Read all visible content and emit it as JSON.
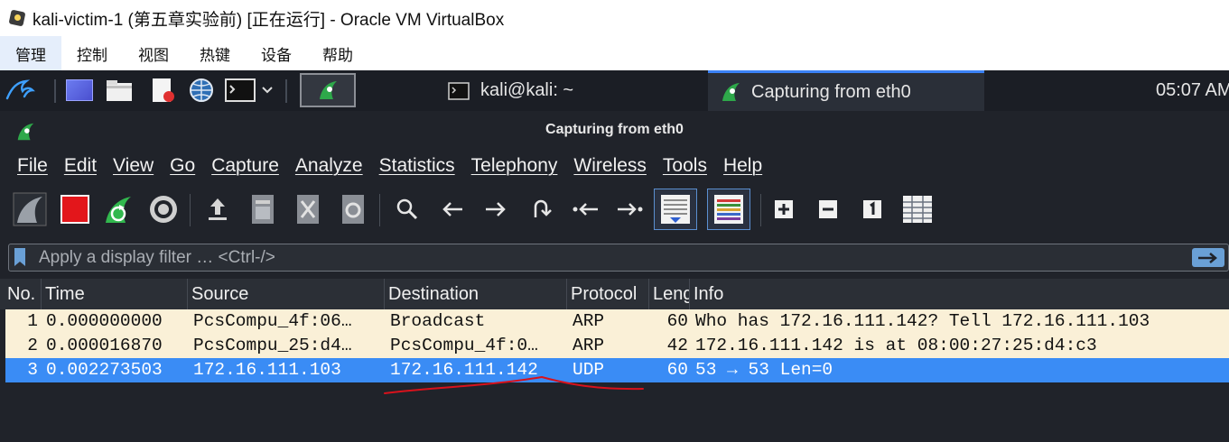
{
  "host_window": {
    "title": "kali-victim-1 (第五章实验前) [正在运行] - Oracle VM VirtualBox",
    "menu": [
      "管理",
      "控制",
      "视图",
      "热键",
      "设备",
      "帮助"
    ]
  },
  "kali_panel": {
    "tasks": [
      {
        "label": "kali@kali: ~",
        "icon": "terminal-icon"
      },
      {
        "label": "Capturing from eth0",
        "icon": "wireshark-fin-icon"
      }
    ],
    "clock": "05:07 AM"
  },
  "wireshark": {
    "title": "Capturing from eth0",
    "menu": [
      "File",
      "Edit",
      "View",
      "Go",
      "Capture",
      "Analyze",
      "Statistics",
      "Telephony",
      "Wireless",
      "Tools",
      "Help"
    ],
    "toolbar_icons": [
      "start-capture-icon",
      "stop-capture-icon",
      "restart-capture-icon",
      "capture-options-icon",
      "open-file-icon",
      "save-file-icon",
      "close-file-icon",
      "reload-file-icon",
      "find-packet-icon",
      "go-back-icon",
      "go-forward-icon",
      "go-to-packet-icon",
      "first-packet-icon",
      "last-packet-icon",
      "autoscroll-icon",
      "colorize-icon",
      "zoom-in-icon",
      "zoom-out-icon",
      "normal-size-icon",
      "resize-columns-icon"
    ],
    "filter": {
      "placeholder": "Apply a display filter … <Ctrl-/>",
      "value": ""
    },
    "columns": [
      "No.",
      "Time",
      "Source",
      "Destination",
      "Protocol",
      "Length",
      "Info"
    ],
    "packets": [
      {
        "no": "1",
        "time": "0.000000000",
        "source": "PcsCompu_4f:06…",
        "destination": "Broadcast",
        "protocol": "ARP",
        "length": "60",
        "info": "Who has 172.16.111.142? Tell 172.16.111.103"
      },
      {
        "no": "2",
        "time": "0.000016870",
        "source": "PcsCompu_25:d4…",
        "destination": "PcsCompu_4f:0…",
        "protocol": "ARP",
        "length": "42",
        "info": "172.16.111.142 is at 08:00:27:25:d4:c3"
      },
      {
        "no": "3",
        "time": "0.002273503",
        "source": "172.16.111.103",
        "destination": "172.16.111.142",
        "protocol": "UDP",
        "length": "60",
        "info": "53 → 53 Len=0"
      }
    ],
    "colors": {
      "arp_row": "#faf0d7",
      "selected_row": "#3a8cf5",
      "annotation": "#d8121c"
    }
  }
}
